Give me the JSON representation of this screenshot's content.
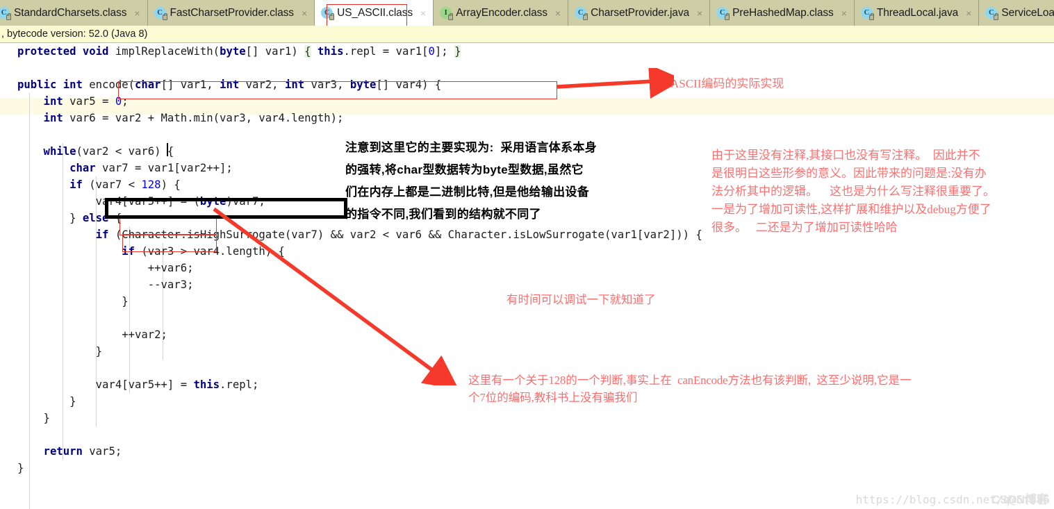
{
  "window": {
    "app": "IntelliJ IDEA decompiled class viewer"
  },
  "tabs": {
    "items": [
      {
        "label": "StandardCharsets.class",
        "icon": "java-class-icon",
        "icon_kind": "class",
        "active": false,
        "close": "×"
      },
      {
        "label": "FastCharsetProvider.class",
        "icon": "java-class-icon",
        "icon_kind": "class",
        "active": false,
        "close": "×"
      },
      {
        "label": "US_ASCII.class",
        "icon": "java-class-icon",
        "icon_kind": "class",
        "active": true,
        "close": "×"
      },
      {
        "label": "ArrayEncoder.class",
        "icon": "java-interface-icon",
        "icon_kind": "interface",
        "active": false,
        "close": "×"
      },
      {
        "label": "CharsetProvider.java",
        "icon": "java-class-icon",
        "icon_kind": "class",
        "active": false,
        "close": "×"
      },
      {
        "label": "PreHashedMap.class",
        "icon": "java-class-icon",
        "icon_kind": "class",
        "active": false,
        "close": "×"
      },
      {
        "label": "ThreadLocal.java",
        "icon": "java-class-icon",
        "icon_kind": "class",
        "active": false,
        "close": "×"
      },
      {
        "label": "ServiceLoade",
        "icon": "java-class-icon",
        "icon_kind": "class",
        "active": false,
        "close": ""
      }
    ]
  },
  "notice": {
    "text": ", bytecode version: 52.0 (Java 8)"
  },
  "code": {
    "lines": [
      [
        {
          "t": "protected ",
          "c": "kw"
        },
        {
          "t": "void ",
          "c": "kw"
        },
        {
          "t": "implReplaceWith(",
          "c": "plain"
        },
        {
          "t": "byte",
          "c": "kw"
        },
        {
          "t": "[] var1) ",
          "c": "plain"
        },
        {
          "t": "{",
          "c": "hl"
        },
        {
          "t": " ",
          "c": "plain"
        },
        {
          "t": "this",
          "c": "kw"
        },
        {
          "t": ".repl = var1[",
          "c": "plain"
        },
        {
          "t": "0",
          "c": "num"
        },
        {
          "t": "]; ",
          "c": "plain"
        },
        {
          "t": "}",
          "c": "hl"
        }
      ],
      [],
      [
        {
          "t": "public ",
          "c": "kw"
        },
        {
          "t": "int ",
          "c": "kw"
        },
        {
          "t": "encode(",
          "c": "plain"
        },
        {
          "t": "char",
          "c": "kw"
        },
        {
          "t": "[] var1, ",
          "c": "plain"
        },
        {
          "t": "int",
          "c": "kw"
        },
        {
          "t": " var2, ",
          "c": "plain"
        },
        {
          "t": "int",
          "c": "kw"
        },
        {
          "t": " var3, ",
          "c": "plain"
        },
        {
          "t": "byte",
          "c": "kw"
        },
        {
          "t": "[] var4) {",
          "c": "plain"
        }
      ],
      [
        {
          "t": "    int",
          "c": "kw"
        },
        {
          "t": " var5 = ",
          "c": "plain"
        },
        {
          "t": "0",
          "c": "num"
        },
        {
          "t": ";",
          "c": "plain"
        }
      ],
      [
        {
          "t": "    int",
          "c": "kw"
        },
        {
          "t": " var6 = var2 + Math.min(var3, var4.length);",
          "c": "plain"
        }
      ],
      [],
      [
        {
          "t": "    while",
          "c": "kw"
        },
        {
          "t": "(var2 < var6) {",
          "c": "plain"
        }
      ],
      [
        {
          "t": "        char",
          "c": "kw"
        },
        {
          "t": " var7 = var1[var2++];",
          "c": "plain"
        }
      ],
      [
        {
          "t": "        if",
          "c": "kw"
        },
        {
          "t": " (var7 < ",
          "c": "plain"
        },
        {
          "t": "128",
          "c": "num"
        },
        {
          "t": ") {",
          "c": "plain"
        }
      ],
      [
        {
          "t": "            var4[var5++] = (",
          "c": "plain"
        },
        {
          "t": "byte",
          "c": "kw"
        },
        {
          "t": ")var7;",
          "c": "plain"
        }
      ],
      [
        {
          "t": "        } ",
          "c": "plain"
        },
        {
          "t": "else",
          "c": "kw"
        },
        {
          "t": " {",
          "c": "plain"
        }
      ],
      [
        {
          "t": "            if",
          "c": "kw"
        },
        {
          "t": " (Character.isHighSurrogate(var7) && var2 < var6 && Character.isLowSurrogate(var1[var2])) {",
          "c": "plain"
        }
      ],
      [
        {
          "t": "                if",
          "c": "kw"
        },
        {
          "t": " (var3 > var4.length) {",
          "c": "plain"
        }
      ],
      [
        {
          "t": "                    ++var6;",
          "c": "plain"
        }
      ],
      [
        {
          "t": "                    --var3;",
          "c": "plain"
        }
      ],
      [
        {
          "t": "                }",
          "c": "plain"
        }
      ],
      [],
      [
        {
          "t": "                ++var2;",
          "c": "plain"
        }
      ],
      [
        {
          "t": "            }",
          "c": "plain"
        }
      ],
      [],
      [
        {
          "t": "            var4[var5++] = ",
          "c": "plain"
        },
        {
          "t": "this",
          "c": "kw"
        },
        {
          "t": ".repl;",
          "c": "plain"
        }
      ],
      [
        {
          "t": "        }",
          "c": "plain"
        }
      ],
      [
        {
          "t": "    }",
          "c": "plain"
        }
      ],
      [],
      [
        {
          "t": "    return",
          "c": "kw"
        },
        {
          "t": " var5;",
          "c": "plain"
        }
      ],
      [
        {
          "t": "}",
          "c": "plain"
        }
      ]
    ]
  },
  "annotations": {
    "ascii_note": "ASCII编码的实际实现",
    "black_note": "注意到这里它的主要实现为:  采用语言体系本身\n的强转,将char型数据转为byte型数据,虽然它\n们在内存上都是二进制比特,但是他给输出设备\n的指令不同,我们看到的结构就不同了",
    "right_note": "由于这里没有注释,其接口也没有写注释。  因此并不\n是很明白这些形参的意义。因此带来的问题是:没有办\n法分析其中的逻辑。    这也是为什么写注释很重要了。\n一是为了增加可读性,这样扩展和维护以及debug方便了\n很多。   二还是为了增加可读性哈哈",
    "debug_note": "有时间可以调试一下就知道了",
    "bottom_note": "这里有一个关于128的一个判断,事实上在  canEncode方法也有该判断,  这至少说明,它是一\n个7位的编码,教科书上没有骗我们"
  },
  "watermark": {
    "url": "https://blog.csdn.net/q@5fc85",
    "brand": "CSDN博客"
  },
  "colors": {
    "tabbar_bg": "#cfcfaa",
    "active_tab_bg": "#ffffff",
    "notice_bg": "#fbfbd4",
    "keyword": "#000080",
    "number": "#0000ff",
    "annotation_red": "#fb7171",
    "highlight_box_red": "#e2382a",
    "arrow_red": "#f5392a",
    "current_line": "#fdfbe4"
  }
}
